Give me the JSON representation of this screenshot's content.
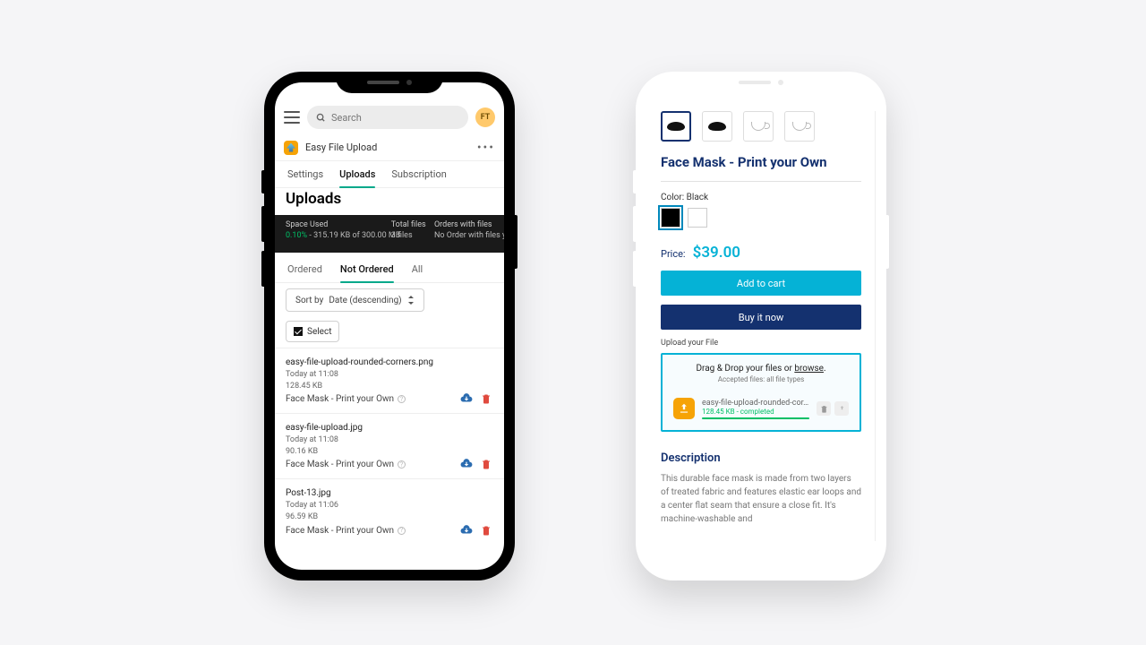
{
  "admin": {
    "search_placeholder": "Search",
    "avatar_initials": "FT",
    "app_name": "Easy File Upload",
    "tabs": {
      "settings": "Settings",
      "uploads": "Uploads",
      "subscription": "Subscription"
    },
    "page_title": "Uploads",
    "stats": {
      "space_label": "Space Used",
      "space_value_pct": "0.10%",
      "space_value_rest": " - 315.19 KB of 300.00 MB",
      "files_label": "Total files",
      "files_value": "3 files",
      "orders_label": "Orders with files",
      "orders_value": "No Order with files ye"
    },
    "subtabs": {
      "ordered": "Ordered",
      "not_ordered": "Not Ordered",
      "all": "All"
    },
    "sort_prefix": "Sort by ",
    "sort_value": "Date (descending)",
    "select_label": "Select",
    "items": [
      {
        "name": "easy-file-upload-rounded-corners.png",
        "time": "Today at 11:08",
        "size": "128.45 KB",
        "product": "Face Mask - Print your Own"
      },
      {
        "name": "easy-file-upload.jpg",
        "time": "Today at 11:08",
        "size": "90.16 KB",
        "product": "Face Mask - Print your Own"
      },
      {
        "name": "Post-13.jpg",
        "time": "Today at 11:06",
        "size": "96.59 KB",
        "product": "Face Mask - Print your Own"
      }
    ]
  },
  "store": {
    "title": "Face Mask - Print your Own",
    "color_label": "Color:",
    "color_value": "Black",
    "price_label": "Price:",
    "price_value": "$39.00",
    "add_to_cart": "Add to cart",
    "buy_now": "Buy it now",
    "upload_label": "Upload your File",
    "dz_text_a": "Drag & Drop your files or ",
    "dz_text_b": "browse",
    "dz_sub": "Accepted files: all file types",
    "dz_file_name": "easy-file-upload-rounded-cor…",
    "dz_file_status": "128.45 KB - completed",
    "desc_title": "Description",
    "desc_body": "This durable face mask is made from two layers of treated fabric and features elastic ear loops and a center flat seam that ensure a close fit. It's machine-washable and"
  }
}
